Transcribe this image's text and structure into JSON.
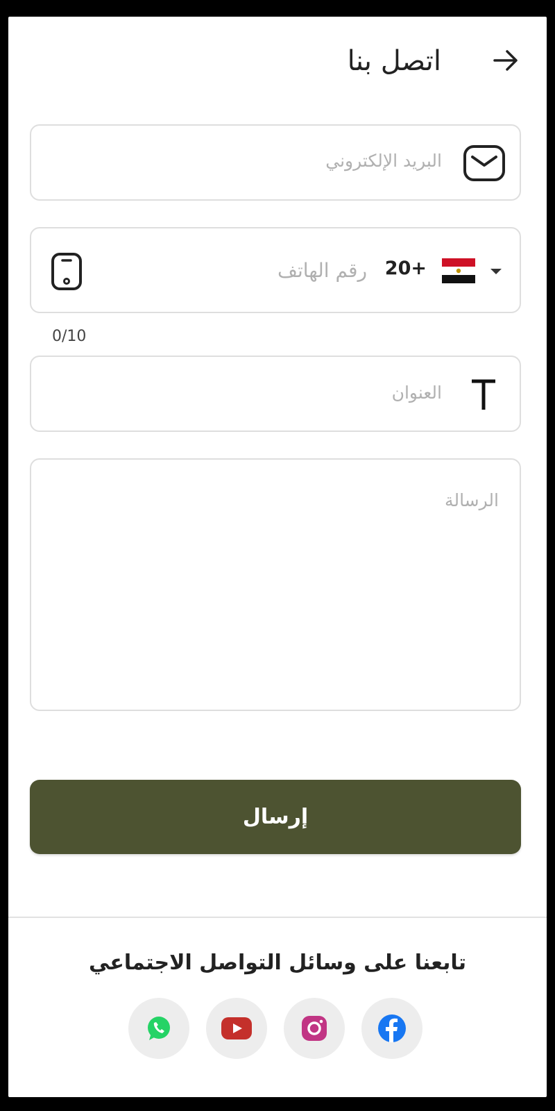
{
  "header": {
    "title": "اتصل بنا",
    "back_icon": "arrow-right-icon"
  },
  "form": {
    "email": {
      "placeholder": "البريد الإلكتروني",
      "icon": "envelope-icon"
    },
    "phone": {
      "placeholder": "رقم الهاتف",
      "country_code": "20+",
      "country_flag": "egypt-flag",
      "icon": "mobile-phone-icon",
      "counter": "0/10"
    },
    "subject": {
      "placeholder": "العنوان",
      "icon": "text-t-icon"
    },
    "message": {
      "placeholder": "الرسالة"
    },
    "submit_label": "إرسال"
  },
  "social": {
    "title": "تابعنا على وسائل التواصل الاجتماعي",
    "items": [
      {
        "name": "whatsapp",
        "icon": "whatsapp-icon",
        "color": "#25d366"
      },
      {
        "name": "youtube",
        "icon": "youtube-icon",
        "color": "#c4302b"
      },
      {
        "name": "instagram",
        "icon": "instagram-icon",
        "color": "#c13584"
      },
      {
        "name": "facebook",
        "icon": "facebook-icon",
        "color": "#1877f2"
      }
    ]
  },
  "colors": {
    "primary_button": "#4d5331",
    "field_border": "#dedede",
    "placeholder": "#b0b0b0"
  }
}
